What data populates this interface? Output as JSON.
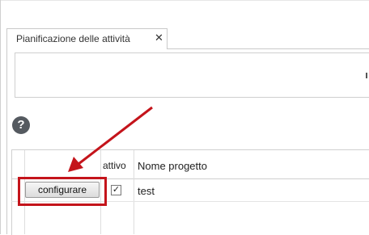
{
  "tab": {
    "label": "Pianificazione delle attività",
    "close_glyph": "✕"
  },
  "help": {
    "glyph": "?"
  },
  "grid": {
    "columns": [
      "",
      "attivo",
      "Nome progetto"
    ],
    "rows": [
      {
        "button_label": "configurare",
        "active_glyph": "✓",
        "active": true,
        "project_name": "test"
      }
    ]
  },
  "annotation": {
    "color": "#c4141b"
  }
}
